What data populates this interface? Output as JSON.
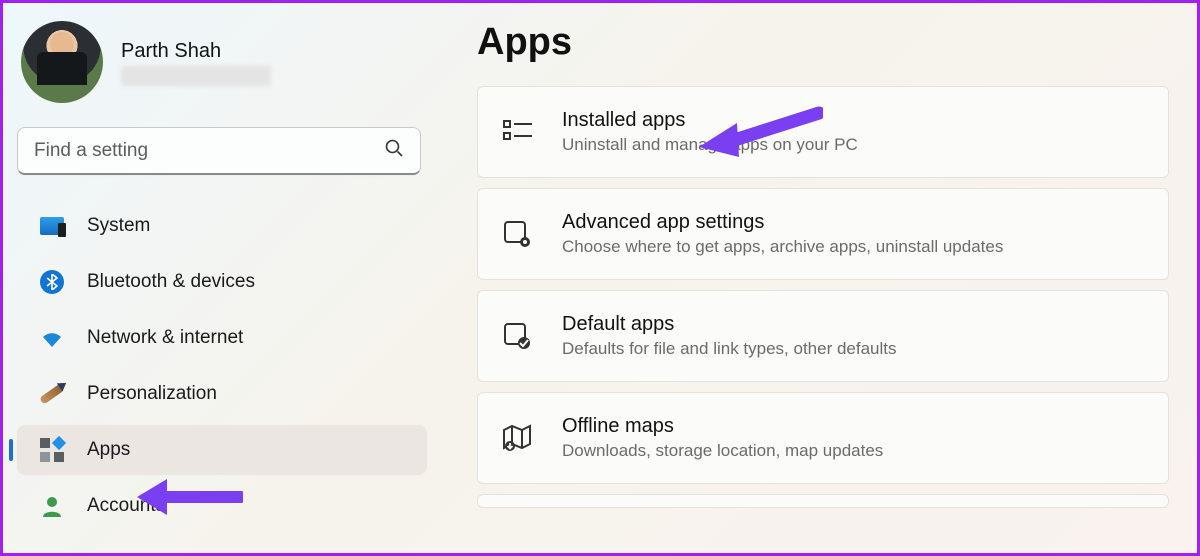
{
  "user": {
    "name": "Parth Shah"
  },
  "search": {
    "placeholder": "Find a setting"
  },
  "sidebar": {
    "items": [
      {
        "label": "System",
        "icon": "system-icon"
      },
      {
        "label": "Bluetooth & devices",
        "icon": "bluetooth-icon"
      },
      {
        "label": "Network & internet",
        "icon": "wifi-icon"
      },
      {
        "label": "Personalization",
        "icon": "paintbrush-icon"
      },
      {
        "label": "Apps",
        "icon": "apps-icon",
        "active": true
      },
      {
        "label": "Accounts",
        "icon": "person-icon"
      }
    ]
  },
  "page": {
    "title": "Apps"
  },
  "cards": [
    {
      "title": "Installed apps",
      "desc": "Uninstall and manage apps on your PC",
      "icon": "list-icon"
    },
    {
      "title": "Advanced app settings",
      "desc": "Choose where to get apps, archive apps, uninstall updates",
      "icon": "app-gear-icon"
    },
    {
      "title": "Default apps",
      "desc": "Defaults for file and link types, other defaults",
      "icon": "defaults-icon"
    },
    {
      "title": "Offline maps",
      "desc": "Downloads, storage location, map updates",
      "icon": "map-icon"
    }
  ],
  "annotations": {
    "arrow_color": "#7b3ff2"
  }
}
